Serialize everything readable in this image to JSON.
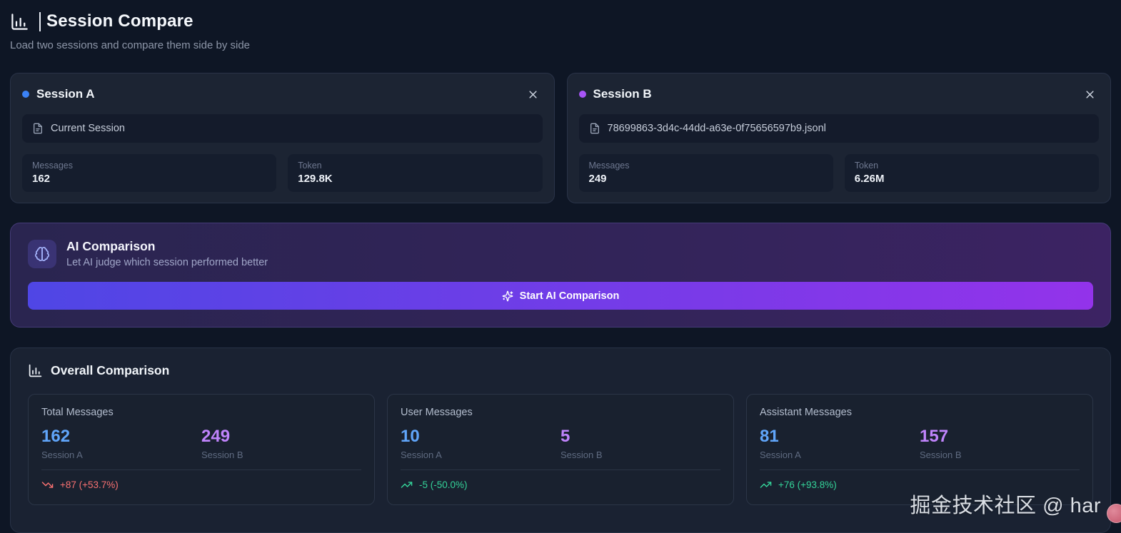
{
  "header": {
    "title": "Session Compare",
    "subtitle": "Load two sessions and compare them side by side"
  },
  "sessions": [
    {
      "name": "Session A",
      "file": "Current Session",
      "stats": [
        {
          "label": "Messages",
          "value": "162"
        },
        {
          "label": "Token",
          "value": "129.8K"
        }
      ]
    },
    {
      "name": "Session B",
      "file": "78699863-3d4c-44dd-a63e-0f75656597b9.jsonl",
      "stats": [
        {
          "label": "Messages",
          "value": "249"
        },
        {
          "label": "Token",
          "value": "6.26M"
        }
      ]
    }
  ],
  "ai_comparison": {
    "title": "AI Comparison",
    "subtitle": "Let AI judge which session performed better",
    "button_label": "Start AI Comparison"
  },
  "overall": {
    "title": "Overall Comparison",
    "cards": [
      {
        "title": "Total Messages",
        "session_a_value": "162",
        "session_a_label": "Session A",
        "session_b_value": "249",
        "session_b_label": "Session B",
        "trend": "+87 (+53.7%)",
        "trend_direction": "down"
      },
      {
        "title": "User Messages",
        "session_a_value": "10",
        "session_a_label": "Session A",
        "session_b_value": "5",
        "session_b_label": "Session B",
        "trend": "-5 (-50.0%)",
        "trend_direction": "up"
      },
      {
        "title": "Assistant Messages",
        "session_a_value": "81",
        "session_a_label": "Session A",
        "session_b_value": "157",
        "session_b_label": "Session B",
        "trend": "+76 (+93.8%)",
        "trend_direction": "up"
      }
    ]
  },
  "watermark": "掘金技术社区 @ har",
  "colors": {
    "page_background": "#0e1625",
    "session_a_dot": "#3b82f6",
    "session_b_dot": "#a855f7",
    "session_a_value": "#60a5fa",
    "session_b_value": "#c084fc",
    "trend_up": "#34d399",
    "trend_down": "#f87171",
    "button_gradient_start": "#4f46e5",
    "button_gradient_end": "#9333ea"
  }
}
